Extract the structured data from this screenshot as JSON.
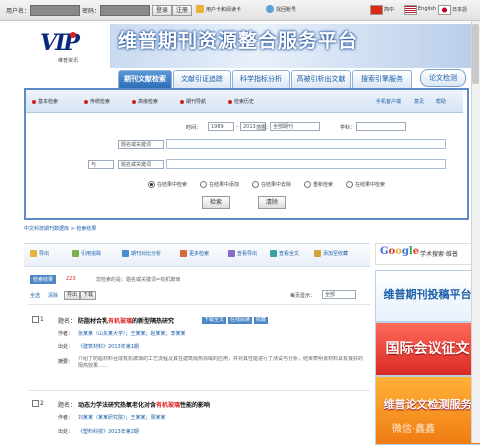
{
  "topbar": {
    "username_label": "用户名：",
    "password_label": "密码：",
    "login_label": "登录",
    "register_label": "注册",
    "user_center_label": "用户卡和阅读卡",
    "forgot_label": "找回账号",
    "lang_cn": "简中",
    "lang_en": "English",
    "lang_jp": "日本語"
  },
  "header": {
    "logo_text": "VIP",
    "logo_sub": "维普资讯",
    "banner_title": "维普期刊资源整合服务平台"
  },
  "nav": {
    "tabs": [
      {
        "label": "期刊文献检索",
        "active": true
      },
      {
        "label": "文献引证追踪",
        "active": false
      },
      {
        "label": "科学指标分析",
        "active": false
      },
      {
        "label": "高被引析出文献",
        "active": false
      },
      {
        "label": "搜索引擎服务",
        "active": false
      }
    ],
    "paper_check": "论文检测"
  },
  "search": {
    "modes": [
      "基本检索",
      "传统检索",
      "高级检索",
      "期刊导航",
      "检索历史"
    ],
    "right_links": [
      "手机客户端",
      "意见",
      "帮助"
    ],
    "time_label": "时间：",
    "year_from": "1989",
    "year_to": "2013",
    "range_label": "范围：",
    "range_value": "全部期刊",
    "subject_label": "学科：",
    "subject_value": "",
    "row1_field": "题名或关键词",
    "row2_op": "与",
    "row2_field": "题名或关键词",
    "radios": [
      "在结果中检索",
      "在结果中添加",
      "在结果中去除",
      "重新检索",
      "在结果中检索"
    ],
    "search_btn": "检索",
    "clear_btn": "清除"
  },
  "breadcrumb": "中文科技期刊数据库 > 检索结果",
  "toolbar": {
    "items": [
      "导出",
      "引用追踪",
      "期刊对比分析",
      "更多检索",
      "查看导出",
      "查看全文",
      "添加至收藏"
    ],
    "google_label": "Google",
    "google_suffix": "学术搜索·维普"
  },
  "results": {
    "count_label": "检索结果",
    "count_value": "223",
    "sort_hint": "您检索的是：题名或关键词=有机玻璃",
    "tools": [
      "全选",
      "清除",
      "导出",
      "下载"
    ],
    "per_page_label": "每页显示：",
    "per_page_value": "全部",
    "items": [
      {
        "num": "1",
        "title_prefix": "题名：",
        "title_a": "防脂材合乳",
        "title_hl": "有机玻璃",
        "title_b": "的新型隔热研究",
        "tags": [
          "下载全文",
          "在线阅读",
          "收藏"
        ],
        "author_label": "作者：",
        "authors": "张某某（山东某大学）；王某某；赵某某；李某某",
        "source_label": "出处：",
        "source": "《建筑材料》2013年第1期",
        "abstract_label": "摘要：",
        "abstract": "介绍了防脂材料合成有机玻璃的工艺流程及其在建筑隔热领域的应用，并对其性能进行了测试与分析，结果表明该材料具有良好的隔热效果……"
      },
      {
        "num": "2",
        "title_prefix": "题名：",
        "title_a": "动态力学法研究热氧老化对含",
        "title_hl": "有机玻璃",
        "title_b": "性能的影响",
        "tags": [],
        "author_label": "作者：",
        "authors": "刘某某（某某研究院）；王某某；周某某",
        "source_label": "出处：",
        "source": "《塑料科技》2013年第2期",
        "abstract_label": "",
        "abstract": ""
      }
    ]
  },
  "ads": {
    "ad1": "维普期刊投稿平台",
    "ad2": "国际会议征文",
    "ad3": "维普论文检测服务"
  },
  "watermark": "微信·鑫鑫"
}
